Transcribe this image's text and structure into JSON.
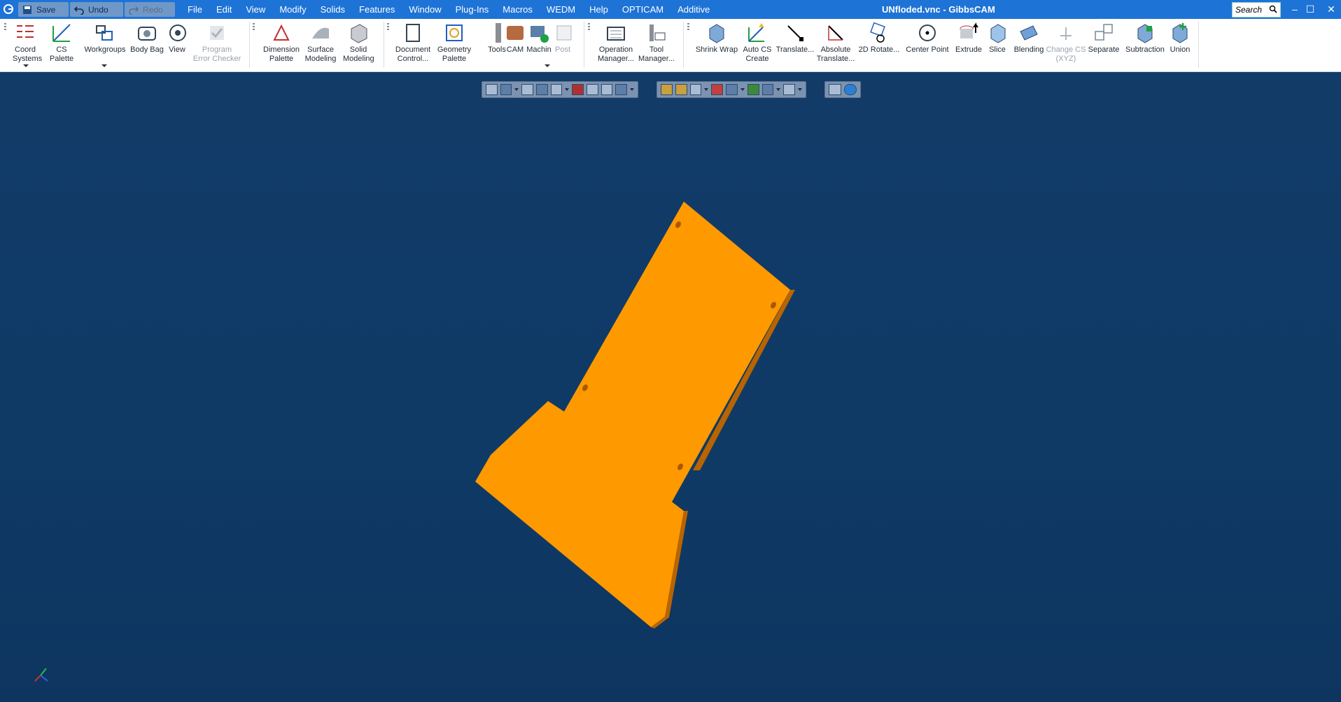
{
  "titlebar": {
    "app_icon": "gibbscam-app-icon",
    "save_label": "Save",
    "undo_label": "Undo",
    "redo_label": "Redo",
    "menus": [
      "File",
      "Edit",
      "View",
      "Modify",
      "Solids",
      "Features",
      "Window",
      "Plug-Ins",
      "Macros",
      "WEDM",
      "Help",
      "OPTICAM",
      "Additive"
    ],
    "document_title": "UNfloded.vnc - GibbsCAM",
    "search_placeholder": "Search",
    "minimize_glyph": "–",
    "maximize_glyph": "☐",
    "close_glyph": "✕"
  },
  "ribbon": {
    "tools": [
      {
        "id": "coord-systems",
        "line1": "Coord",
        "line2": "Systems",
        "icon": "coord-systems-icon",
        "enabled": true
      },
      {
        "id": "cs-palette",
        "line1": "CS Palette",
        "line2": "",
        "icon": "cs-palette-icon",
        "enabled": true
      },
      {
        "id": "workgroups",
        "line1": "Workgroups",
        "line2": "",
        "icon": "workgroups-icon",
        "enabled": true
      },
      {
        "id": "body-bag",
        "line1": "Body Bag",
        "line2": "",
        "icon": "body-bag-icon",
        "enabled": true
      },
      {
        "id": "view",
        "line1": "View",
        "line2": "",
        "icon": "view-icon",
        "enabled": true
      },
      {
        "id": "program-error-checker",
        "line1": "Program",
        "line2": "Error Checker",
        "icon": "check-icon",
        "enabled": false
      },
      {
        "id": "dimension-palette",
        "line1": "Dimension",
        "line2": "Palette",
        "icon": "dimension-icon",
        "enabled": true
      },
      {
        "id": "surface-modeling",
        "line1": "Surface",
        "line2": "Modeling",
        "icon": "surface-icon",
        "enabled": true
      },
      {
        "id": "solid-modeling",
        "line1": "Solid",
        "line2": "Modeling",
        "icon": "solid-icon",
        "enabled": true
      },
      {
        "id": "document-control",
        "line1": "Document",
        "line2": "Control...",
        "icon": "document-icon",
        "enabled": true
      },
      {
        "id": "geometry-palette",
        "line1": "Geometry",
        "line2": "Palette",
        "icon": "geometry-icon",
        "enabled": true
      },
      {
        "id": "tools",
        "line1": "Tools",
        "line2": "",
        "icon": "tools-icon",
        "enabled": true
      },
      {
        "id": "cam",
        "line1": "CAM",
        "line2": "",
        "icon": "cam-icon",
        "enabled": true
      },
      {
        "id": "machining",
        "line1": "Machin",
        "line2": "",
        "icon": "machining-icon",
        "enabled": true
      },
      {
        "id": "post",
        "line1": "Post",
        "line2": "",
        "icon": "post-icon",
        "enabled": false
      },
      {
        "id": "operation-manager",
        "line1": "Operation",
        "line2": "Manager...",
        "icon": "operation-manager-icon",
        "enabled": true
      },
      {
        "id": "tool-manager",
        "line1": "Tool",
        "line2": "Manager...",
        "icon": "tool-manager-icon",
        "enabled": true
      },
      {
        "id": "shrink-wrap",
        "line1": "Shrink Wrap",
        "line2": "",
        "icon": "shrink-wrap-icon",
        "enabled": true
      },
      {
        "id": "auto-cs-create",
        "line1": "Auto CS",
        "line2": "Create",
        "icon": "auto-cs-icon",
        "enabled": true
      },
      {
        "id": "translate",
        "line1": "Translate...",
        "line2": "",
        "icon": "translate-icon",
        "enabled": true
      },
      {
        "id": "absolute-translate",
        "line1": "Absolute",
        "line2": "Translate...",
        "icon": "absolute-translate-icon",
        "enabled": true
      },
      {
        "id": "2d-rotate",
        "line1": "2D Rotate...",
        "line2": "",
        "icon": "rotate-icon",
        "enabled": true
      },
      {
        "id": "center-point",
        "line1": "Center Point",
        "line2": "",
        "icon": "center-point-icon",
        "enabled": true
      },
      {
        "id": "extrude",
        "line1": "Extrude",
        "line2": "",
        "icon": "extrude-icon",
        "enabled": true
      },
      {
        "id": "slice",
        "line1": "Slice",
        "line2": "",
        "icon": "slice-icon",
        "enabled": true
      },
      {
        "id": "blending",
        "line1": "Blending",
        "line2": "",
        "icon": "blending-icon",
        "enabled": true
      },
      {
        "id": "change-cs",
        "line1": "Change CS",
        "line2": "(XYZ)",
        "icon": "change-cs-icon",
        "enabled": false
      },
      {
        "id": "separate",
        "line1": "Separate",
        "line2": "",
        "icon": "separate-icon",
        "enabled": true
      },
      {
        "id": "subtraction",
        "line1": "Subtraction",
        "line2": "",
        "icon": "subtraction-icon",
        "enabled": true
      },
      {
        "id": "union",
        "line1": "Union",
        "line2": "",
        "icon": "union-icon",
        "enabled": true
      }
    ]
  },
  "viewport": {
    "background": "#0f3a66",
    "part_color": "#ff9900",
    "part_edge_color": "#b86400",
    "axis_icon": "axis-triad-icon"
  }
}
